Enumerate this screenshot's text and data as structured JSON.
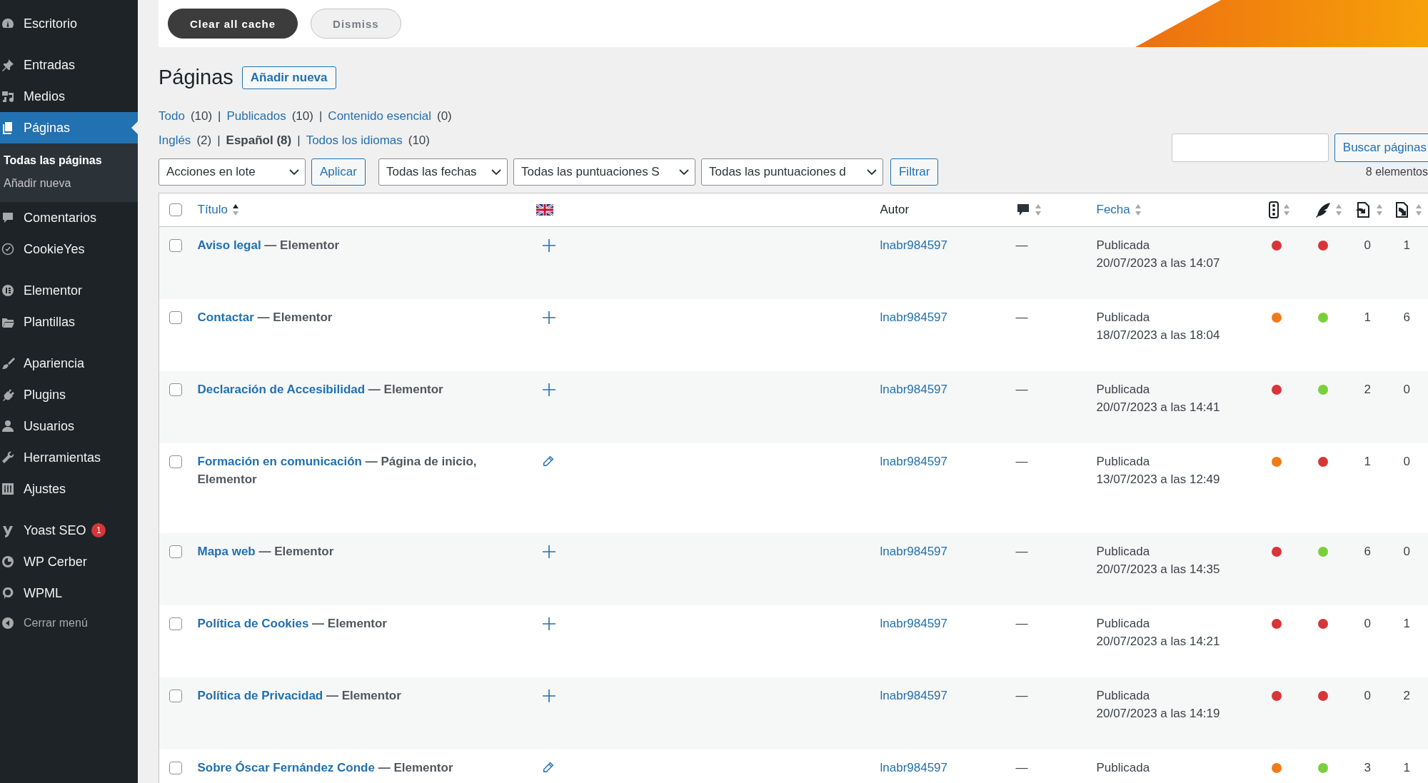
{
  "sidebar": {
    "groups": [
      [
        {
          "label": "Escritorio",
          "selected": false
        }
      ],
      [
        {
          "label": "Entradas",
          "selected": false
        },
        {
          "label": "Medios",
          "selected": false
        },
        {
          "label": "Páginas",
          "selected": true,
          "submenu": [
            {
              "label": "Todas las páginas",
              "selected": true
            },
            {
              "label": "Añadir nueva",
              "selected": false
            }
          ]
        },
        {
          "label": "Comentarios",
          "selected": false
        },
        {
          "label": "CookieYes",
          "selected": false
        }
      ],
      [
        {
          "label": "Elementor",
          "selected": false
        },
        {
          "label": "Plantillas",
          "selected": false
        }
      ],
      [
        {
          "label": "Apariencia",
          "selected": false
        },
        {
          "label": "Plugins",
          "selected": false
        },
        {
          "label": "Usuarios",
          "selected": false
        },
        {
          "label": "Herramientas",
          "selected": false
        },
        {
          "label": "Ajustes",
          "selected": false
        }
      ],
      [
        {
          "label": "Yoast SEO",
          "selected": false,
          "badge": "1"
        },
        {
          "label": "WP Cerber",
          "selected": false
        },
        {
          "label": "WPML",
          "selected": false
        }
      ]
    ],
    "collapse": "Cerrar menú"
  },
  "notice": {
    "buttons": [
      {
        "label": "Clear all cache",
        "kind": "primary"
      },
      {
        "label": "Dismiss",
        "kind": "secondary"
      }
    ]
  },
  "heading": {
    "title": "Páginas",
    "add_new": "Añadir nueva"
  },
  "status_filters": [
    {
      "label": "Todo",
      "count": "(10)",
      "selected": false
    },
    {
      "separator": "|",
      "label": "Publicados",
      "count": "(10)",
      "selected": false
    },
    {
      "separator": "|",
      "label": "Contenido esencial",
      "count": "(0)",
      "selected": false
    }
  ],
  "language_filters": [
    {
      "label": "Inglés",
      "count": "(2)",
      "selected": false
    },
    {
      "separator": "|",
      "label": "Español",
      "count": "(8)",
      "selected": true
    },
    {
      "separator": "|",
      "label": "Todos los idiomas",
      "count": "(10)",
      "selected": false
    }
  ],
  "search": {
    "button": "Buscar páginas"
  },
  "filters": {
    "bulk_action": "Acciones en lote",
    "apply": "Aplicar",
    "selects": [
      "Todas las fechas",
      "Todas las puntuaciones S",
      "Todas las puntuaciones d"
    ],
    "filter": "Filtrar",
    "count": "8 elementos"
  },
  "table": {
    "select_all_checked": false,
    "columns": [
      {
        "kind": "text",
        "label": "Título",
        "sortable": true,
        "sorted": true
      },
      {
        "kind": "icon",
        "sortable": false
      },
      {
        "kind": "text",
        "label": "Autor",
        "sortable": false
      },
      {
        "kind": "icon",
        "sortable": true,
        "sorted": false
      },
      {
        "kind": "text",
        "label": "Fecha",
        "sortable": true,
        "sorted": false
      },
      {
        "kind": "icon",
        "sortable": true,
        "sorted": false
      },
      {
        "kind": "icon",
        "sortable": true,
        "sorted": false
      },
      {
        "kind": "icon",
        "sortable": true,
        "sorted": false
      },
      {
        "kind": "icon",
        "sortable": true,
        "sorted": false
      }
    ],
    "rows": [
      {
        "checked": false,
        "title": "Aviso legal",
        "states": "— Elementor",
        "translated": false,
        "author": "lnabr984597",
        "comments": "—",
        "status": "Publicada",
        "date": "20/07/2023 a las 14:07",
        "seo": {
          "color": "#d63638"
        },
        "readability": {
          "color": "#d63638"
        },
        "links": "0",
        "linked": "1"
      },
      {
        "checked": false,
        "title": "Contactar",
        "states": "— Elementor",
        "translated": false,
        "author": "lnabr984597",
        "comments": "—",
        "status": "Publicada",
        "date": "18/07/2023 a las 18:04",
        "seo": {
          "color": "#ee7c1b"
        },
        "readability": {
          "color": "#7ad03a"
        },
        "links": "1",
        "linked": "6"
      },
      {
        "checked": false,
        "title": "Declaración de Accesibilidad",
        "states": "— Elementor",
        "translated": false,
        "author": "lnabr984597",
        "comments": "—",
        "status": "Publicada",
        "date": "20/07/2023 a las 14:41",
        "seo": {
          "color": "#d63638"
        },
        "readability": {
          "color": "#7ad03a"
        },
        "links": "2",
        "linked": "0"
      },
      {
        "checked": false,
        "title": "Formación en comunicación",
        "states": "— Página de inicio, Elementor",
        "translated": true,
        "author": "lnabr984597",
        "comments": "—",
        "status": "Publicada",
        "date": "13/07/2023 a las 12:49",
        "seo": {
          "color": "#ee7c1b"
        },
        "readability": {
          "color": "#d63638"
        },
        "links": "1",
        "linked": "0"
      },
      {
        "checked": false,
        "title": "Mapa web",
        "states": "— Elementor",
        "translated": false,
        "author": "lnabr984597",
        "comments": "—",
        "status": "Publicada",
        "date": "20/07/2023 a las 14:35",
        "seo": {
          "color": "#d63638"
        },
        "readability": {
          "color": "#7ad03a"
        },
        "links": "6",
        "linked": "0"
      },
      {
        "checked": false,
        "title": "Política de Cookies",
        "states": "— Elementor",
        "translated": false,
        "author": "lnabr984597",
        "comments": "—",
        "status": "Publicada",
        "date": "20/07/2023 a las 14:21",
        "seo": {
          "color": "#d63638"
        },
        "readability": {
          "color": "#d63638"
        },
        "links": "0",
        "linked": "1"
      },
      {
        "checked": false,
        "title": "Política de Privacidad",
        "states": "— Elementor",
        "translated": false,
        "author": "lnabr984597",
        "comments": "—",
        "status": "Publicada",
        "date": "20/07/2023 a las 14:19",
        "seo": {
          "color": "#d63638"
        },
        "readability": {
          "color": "#d63638"
        },
        "links": "0",
        "linked": "2"
      },
      {
        "checked": false,
        "title": "Sobre Óscar Fernández Conde",
        "states": "— Elementor",
        "translated": true,
        "author": "lnabr984597",
        "comments": "—",
        "status": "Publicada",
        "seo": {
          "color": "#ee7c1b"
        },
        "readability": {
          "color": "#7ad03a"
        },
        "links": "3",
        "linked": "1"
      }
    ]
  }
}
